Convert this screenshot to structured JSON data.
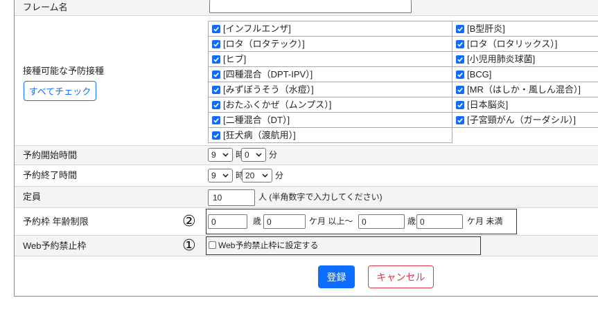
{
  "colors": {
    "primary": "#0d6efd",
    "danger": "#dc3545",
    "text": "#212529"
  },
  "icons": {
    "select_arrow": "chevron-down-icon",
    "checkbox_mark": "checkmark-icon"
  },
  "form": {
    "frame_name": {
      "label": "フレーム名",
      "value": ""
    },
    "vaccines": {
      "label": "接種可能な予防接種",
      "check_all_label": "すべてチェック",
      "items": [
        {
          "label": "[インフルエンザ]",
          "checked": true
        },
        {
          "label": "[B型肝炎]",
          "checked": true
        },
        {
          "label": "[ロタ（ロタテック）]",
          "checked": true
        },
        {
          "label": "[ロタ（ロタリックス）]",
          "checked": true
        },
        {
          "label": "[ヒブ]",
          "checked": true
        },
        {
          "label": "[小児用肺炎球菌]",
          "checked": true
        },
        {
          "label": "[四種混合（DPT-IPV）]",
          "checked": true
        },
        {
          "label": "[BCG]",
          "checked": true
        },
        {
          "label": "[みずぼうそう（水痘）]",
          "checked": true
        },
        {
          "label": "[MR（はしか・風しん混合）]",
          "checked": true
        },
        {
          "label": "[おたふくかぜ（ムンプス）]",
          "checked": true
        },
        {
          "label": "[日本脳炎]",
          "checked": true
        },
        {
          "label": "[二種混合（DT）]",
          "checked": true
        },
        {
          "label": "[子宮頸がん（ガーダシル）]",
          "checked": true
        },
        {
          "label": "[狂犬病（渡航用）]",
          "checked": true
        }
      ]
    },
    "start_time": {
      "label": "予約開始時間",
      "hour": "9",
      "hour_unit": "時",
      "minute": "0",
      "minute_unit": "分"
    },
    "end_time": {
      "label": "予約終了時間",
      "hour": "9",
      "hour_unit": "時",
      "minute": "20",
      "minute_unit": "分"
    },
    "capacity": {
      "label": "定員",
      "value": "10",
      "note": "人 (半角数字で入力してください)"
    },
    "age_limit": {
      "label": "予約枠 年齢制限",
      "marker": "②",
      "min_years": "0",
      "min_years_unit": "歳",
      "min_months": "0",
      "min_months_unit": "ケ月 以上～",
      "max_years": "0",
      "max_years_unit": "歳",
      "max_months": "0",
      "max_months_unit": "ケ月 未満"
    },
    "web_block": {
      "label": "Web予約禁止枠",
      "marker": "①",
      "checkbox_label": "Web予約禁止枠に設定する",
      "checked": false
    }
  },
  "actions": {
    "submit_label": "登録",
    "cancel_label": "キャンセル"
  }
}
